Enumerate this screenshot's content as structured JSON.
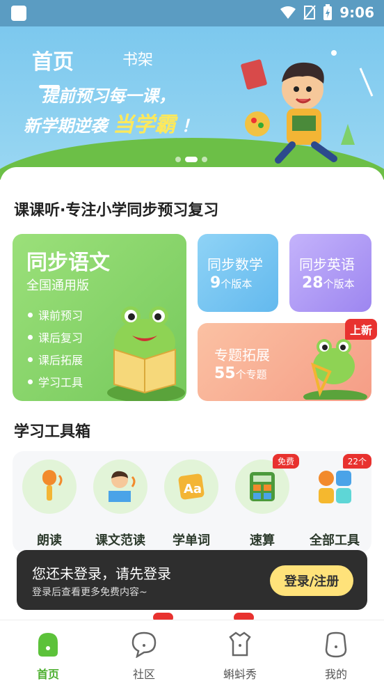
{
  "status_bar": {
    "time": "9:06"
  },
  "banner": {
    "tab_home": "首页",
    "tab_shelf": "书架",
    "slogan_line1": "提前预习每一课，",
    "slogan_line2_prefix": "新学期逆袭",
    "slogan_line2_highlight": "当学霸",
    "slogan_line2_suffix": "！"
  },
  "main": {
    "section_title": "课课听·专注小学同步预习复习",
    "chinese": {
      "title": "同步语文",
      "subtitle": "全国通用版",
      "items": [
        "课前预习",
        "课后复习",
        "课后拓展",
        "学习工具"
      ]
    },
    "math": {
      "title": "同步数学",
      "count": "9",
      "unit": "个版本"
    },
    "english": {
      "title": "同步英语",
      "count": "28",
      "unit": "个版本"
    },
    "topic": {
      "title": "专题拓展",
      "count": "55",
      "unit": "个专题",
      "badge": "上新"
    },
    "toolbox_title": "学习工具箱",
    "tools": [
      {
        "label": "朗读",
        "icon": "microphone-icon"
      },
      {
        "label": "课文范读",
        "icon": "reading-boy-icon"
      },
      {
        "label": "学单词",
        "icon": "word-card-icon"
      },
      {
        "label": "速算",
        "icon": "calculator-icon",
        "tag": "免费"
      },
      {
        "label": "全部工具",
        "icon": "grid-apps-icon",
        "tag": "22个"
      }
    ]
  },
  "toast": {
    "title": "您还未登录，请先登录",
    "subtitle": "登录后查看更多免费内容~",
    "button": "登录/注册"
  },
  "nav": {
    "items": [
      {
        "label": "首页",
        "icon": "home-icon",
        "active": true
      },
      {
        "label": "社区",
        "icon": "community-icon"
      },
      {
        "label": "蝌蚪秀",
        "icon": "tadpole-show-icon"
      },
      {
        "label": "我的",
        "icon": "profile-icon"
      }
    ]
  },
  "colors": {
    "accent_green": "#4caf2f",
    "badge_red": "#e8322f",
    "banner_sky": "#7cc8ee"
  }
}
